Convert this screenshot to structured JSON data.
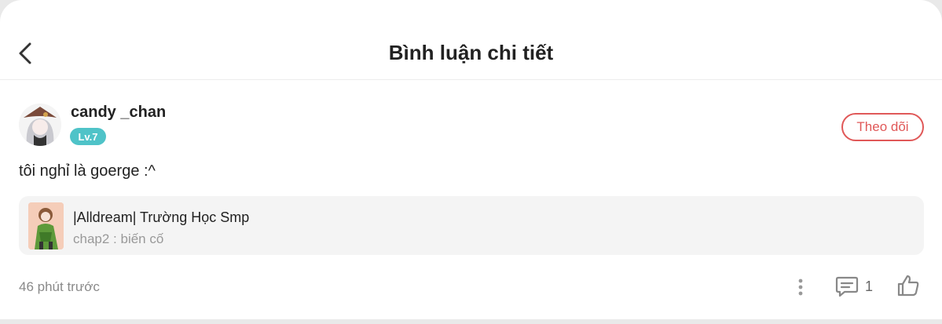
{
  "header": {
    "title": "Bình luận chi tiết",
    "back_icon": "chevron-left-icon"
  },
  "comment": {
    "username": "candy _chan",
    "level": "Lv.7",
    "follow_label": "Theo dõi",
    "text": "tôi nghỉ là goerge :^",
    "time": "46 phút trước",
    "reply_count": "1"
  },
  "story": {
    "title": "|Alldream| Trường Học Smp",
    "chapter": "chap2 : biến cố"
  },
  "colors": {
    "accent_red": "#e05858",
    "level_badge": "#4fc3c8",
    "card_bg": "#f4f4f4"
  }
}
